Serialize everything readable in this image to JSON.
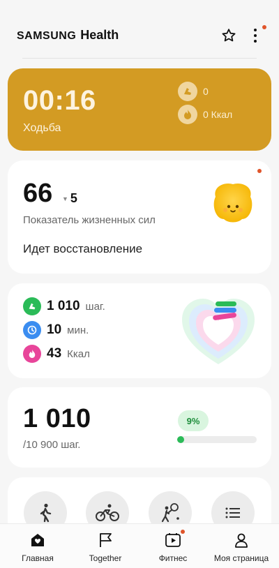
{
  "app": {
    "brand_main": "SAMSUNG",
    "brand_sub": "Health",
    "favorites_icon": "star-outline-icon",
    "more_icon": "kebab-menu-icon",
    "accent_color": "#e0552b"
  },
  "workout": {
    "elapsed": "00:16",
    "type": "Ходьба",
    "steps_value": "0",
    "calories_value": "0 Ккал",
    "color": "#d39b23"
  },
  "vitality": {
    "score": "66",
    "change": "5",
    "label": "Показатель жизненных сил",
    "status": "Идет восстановление"
  },
  "activity": {
    "steps_value": "1 010",
    "steps_unit": "шаг.",
    "minutes_value": "10",
    "minutes_unit": "мин.",
    "calories_value": "43",
    "calories_unit": "Ккал"
  },
  "steps": {
    "count": "1 010",
    "goal": "/10 900 шаг.",
    "percent_label": "9%",
    "progress": 0.09
  },
  "quick_actions": [
    {
      "icon": "walking-icon"
    },
    {
      "icon": "cycling-icon"
    },
    {
      "icon": "tennis-icon"
    },
    {
      "icon": "list-icon"
    }
  ],
  "tabs": [
    {
      "label": "Главная",
      "icon": "home-icon",
      "active": true
    },
    {
      "label": "Together",
      "icon": "flag-icon"
    },
    {
      "label": "Фитнес",
      "icon": "fitness-play-icon",
      "badge": true
    },
    {
      "label": "Моя страница",
      "icon": "profile-icon"
    }
  ]
}
